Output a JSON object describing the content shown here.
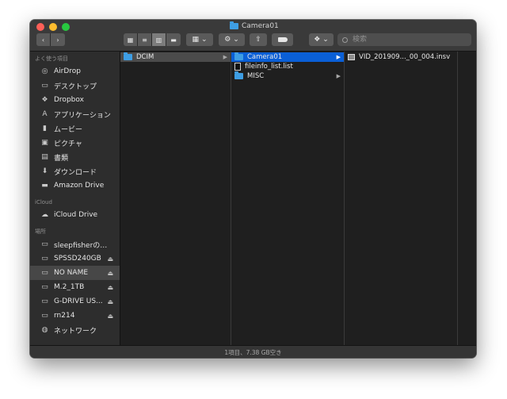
{
  "window": {
    "title": "Camera01"
  },
  "toolbar": {
    "search_placeholder": "検索",
    "action_chevron": "⌄",
    "view_options_chevron": "⌄",
    "dropbox_chevron": "⌄"
  },
  "sidebar": {
    "favorites_header": "よく使う項目",
    "favorites": [
      {
        "label": "AirDrop",
        "icon": "airdrop-icon"
      },
      {
        "label": "デスクトップ",
        "icon": "desktop-icon"
      },
      {
        "label": "Dropbox",
        "icon": "dropbox-icon"
      },
      {
        "label": "アプリケーション",
        "icon": "applications-icon"
      },
      {
        "label": "ムービー",
        "icon": "movies-icon"
      },
      {
        "label": "ピクチャ",
        "icon": "pictures-icon"
      },
      {
        "label": "書類",
        "icon": "documents-icon"
      },
      {
        "label": "ダウンロード",
        "icon": "downloads-icon"
      },
      {
        "label": "Amazon Drive",
        "icon": "folder-icon"
      }
    ],
    "icloud_header": "iCloud",
    "icloud": [
      {
        "label": "iCloud Drive",
        "icon": "icloud-icon"
      }
    ],
    "locations_header": "場所",
    "locations": [
      {
        "label": "sleepfisherのMa...",
        "icon": "laptop-icon",
        "eject": ""
      },
      {
        "label": "SPSSD240GB",
        "icon": "drive-icon",
        "eject": "⏏"
      },
      {
        "label": "NO NAME",
        "icon": "drive-icon",
        "eject": "⏏",
        "selected": true
      },
      {
        "label": "M.2_1TB",
        "icon": "drive-icon",
        "eject": "⏏"
      },
      {
        "label": "G-DRIVE US...",
        "icon": "drive-icon",
        "eject": "⏏"
      },
      {
        "label": "rn214",
        "icon": "display-icon",
        "eject": "⏏"
      },
      {
        "label": "ネットワーク",
        "icon": "network-icon",
        "eject": ""
      }
    ]
  },
  "columns": {
    "col1": [
      {
        "name": "DCIM",
        "type": "folder"
      }
    ],
    "col2": [
      {
        "name": "Camera01",
        "type": "folder"
      },
      {
        "name": "fileinfo_list.list",
        "type": "file"
      },
      {
        "name": "MISC",
        "type": "folder"
      }
    ],
    "col3": [
      {
        "name": "VID_201909..._00_004.insv",
        "type": "video"
      }
    ]
  },
  "status": {
    "text": "1項目、7.38 GB空き"
  }
}
